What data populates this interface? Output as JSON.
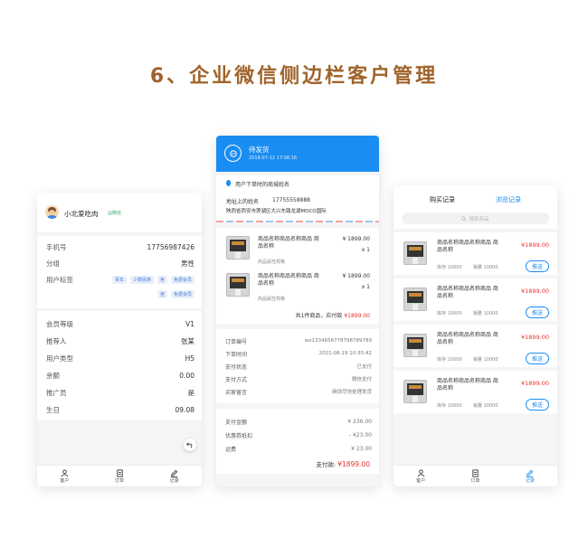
{
  "page_title": "6、企业微信侧边栏客户管理",
  "colors": {
    "accent": "#1a8df2",
    "price": "#e8312f",
    "title": "#a0632b"
  },
  "profile": {
    "name": "小北爱吃肉",
    "wechat_tag": "@微信",
    "fields": [
      {
        "label": "手机号",
        "value": "17756987426"
      },
      {
        "label": "分组",
        "value": "男性"
      },
      {
        "label": "用户标签",
        "value": ""
      }
    ],
    "tags_row1": [
      "青年",
      "少数民族",
      "宫",
      "免费会员"
    ],
    "tags_row2": [
      "宫",
      "免费会员"
    ],
    "member_fields": [
      {
        "label": "会员等级",
        "value": "V1"
      },
      {
        "label": "推荐人",
        "value": "张某"
      },
      {
        "label": "用户类型",
        "value": "H5"
      },
      {
        "label": "余额",
        "value": "0.00"
      },
      {
        "label": "推广员",
        "value": "是"
      },
      {
        "label": "生日",
        "value": "09.08"
      }
    ]
  },
  "tabs": {
    "customer": "客户",
    "order": "订单",
    "record": "记录"
  },
  "order": {
    "status": "待发货",
    "time": "2018-07-12  17:08:16",
    "shop_name": "用户下单时的商城姓名",
    "address_name": "地址上的姓名",
    "phone": "17755558888",
    "address": "陕西省西安市莲湖区大兴东路龙湖MOCO国际",
    "items": [
      {
        "name": "商品名称商品名称商品 商品名称",
        "price": "¥ 1899.00",
        "qty": "x 1",
        "spec": "商品属性规格"
      },
      {
        "name": "商品名称商品名称商品 商品名称",
        "price": "¥ 1899.00",
        "qty": "x 1",
        "spec": "商品属性规格"
      }
    ],
    "summary_label": "共1件商品，应付款",
    "summary_value": "¥1899.00",
    "info": [
      {
        "label": "订单编号",
        "value": "wx1334656778798789789"
      },
      {
        "label": "下单时间",
        "value": "2021-08-19 10:35:42"
      },
      {
        "label": "支付状态",
        "value": "已支付"
      },
      {
        "label": "支付方式",
        "value": "微信支付"
      },
      {
        "label": "买家留言",
        "value": "麻烦尽快处理发货"
      }
    ],
    "pay": [
      {
        "label": "支付金额",
        "value": "¥ 236.00"
      },
      {
        "label": "优惠券抵扣",
        "value": "- ¥23.00"
      },
      {
        "label": "运费",
        "value": "¥ 23.00"
      }
    ],
    "paid_label": "支付款:",
    "paid_value": "¥1899.00"
  },
  "records": {
    "tab_buy": "购买记录",
    "tab_browse": "浏览记录",
    "search_placeholder": "搜索商品",
    "items": [
      {
        "name": "商品名称商品名称商品 商品名称",
        "price": "¥1899.00",
        "stock": "库存 10000",
        "sales": "销量 10000",
        "btn": "推送"
      },
      {
        "name": "商品名称商品名称商品 商品名称",
        "price": "¥1899.00",
        "stock": "库存 10000",
        "sales": "销量 10000",
        "btn": "推送"
      },
      {
        "name": "商品名称商品名称商品 商品名称",
        "price": "¥1899.00",
        "stock": "库存 10000",
        "sales": "销量 10000",
        "btn": "推送"
      },
      {
        "name": "商品名称商品名称商品 商品名称",
        "price": "¥1899.00",
        "stock": "库存 10000",
        "sales": "销量 10000",
        "btn": "推送"
      }
    ]
  }
}
